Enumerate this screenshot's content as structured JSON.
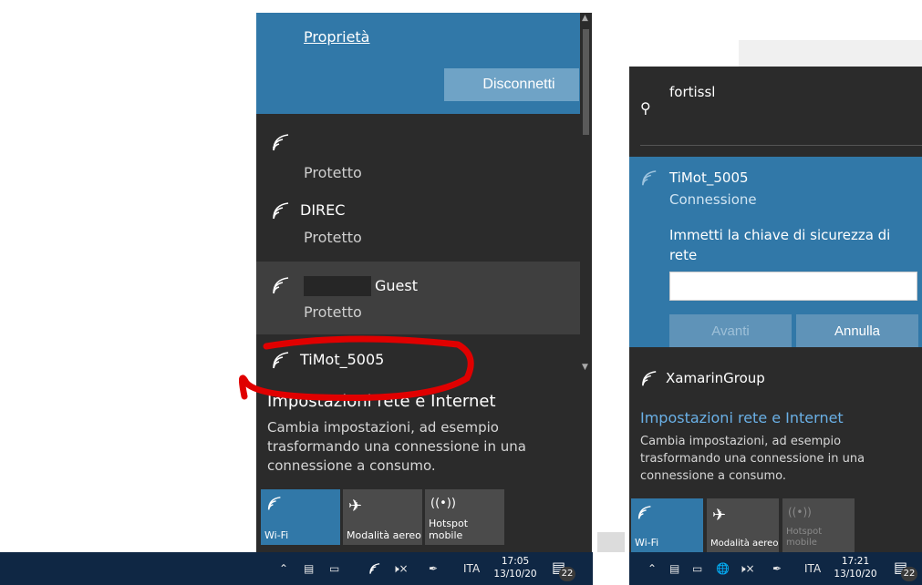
{
  "left": {
    "properties_link": "Proprietà",
    "disconnect_label": "Disconnetti",
    "networks": [
      {
        "name": "",
        "status": "Protetto"
      },
      {
        "name": "DIREC",
        "status": "Protetto"
      },
      {
        "name": "Guest",
        "status": "Protetto"
      },
      {
        "name": "TiMot_5005",
        "status": ""
      }
    ],
    "settings_title": "Impostazioni rete e Internet",
    "settings_desc": "Cambia impostazioni, ad esempio trasformando una connessione in una connessione a consumo.",
    "quick_actions": [
      {
        "label": "Wi-Fi",
        "icon": "wifi-icon"
      },
      {
        "label": "Modalità aereo",
        "icon": "airplane-icon"
      },
      {
        "label": "Hotspot mobile",
        "icon": "hotspot-icon"
      }
    ]
  },
  "right": {
    "networks_top": [
      {
        "name": "fortissl"
      }
    ],
    "selected": {
      "name": "TiMot_5005",
      "status": "Connessione",
      "prompt": "Immetti la chiave di sicurezza di rete",
      "next_label": "Avanti",
      "cancel_label": "Annulla"
    },
    "networks_bottom": [
      {
        "name": "XamarinGroup"
      }
    ],
    "settings_title": "Impostazioni rete e Internet",
    "settings_desc": "Cambia impostazioni, ad esempio trasformando una connessione in una connessione a consumo.",
    "quick_actions": [
      {
        "label": "Wi-Fi",
        "icon": "wifi-icon"
      },
      {
        "label": "Modalità aereo",
        "icon": "airplane-icon"
      },
      {
        "label": "Hotspot mobile",
        "icon": "hotspot-icon"
      }
    ]
  },
  "taskbar_left": {
    "lang": "ITA",
    "time": "17:05",
    "date": "13/10/20",
    "notifications": "22"
  },
  "taskbar_right": {
    "lang": "ITA",
    "time": "17:21",
    "date": "13/10/20",
    "notifications": "22"
  },
  "colors": {
    "accent": "#3178a8",
    "panel": "#2b2b2b",
    "taskbar": "#0f2744",
    "highlight": "#e00000"
  }
}
